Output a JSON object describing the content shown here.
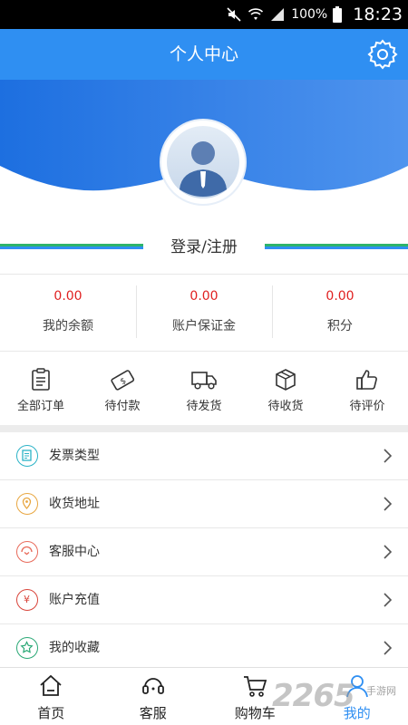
{
  "status_bar": {
    "battery": "100%",
    "time": "18:23"
  },
  "header": {
    "title": "个人中心",
    "settings_icon": "gear-icon"
  },
  "colors": {
    "primary": "#2f8ff2",
    "price": "#e02020",
    "green_line": "#2db46b"
  },
  "login": {
    "label": "登录/注册"
  },
  "stats": [
    {
      "value": "0.00",
      "label": "我的余额"
    },
    {
      "value": "0.00",
      "label": "账户保证金"
    },
    {
      "value": "0.00",
      "label": "积分"
    }
  ],
  "orders": [
    {
      "label": "全部订单",
      "icon": "clipboard-icon"
    },
    {
      "label": "待付款",
      "icon": "payment-icon"
    },
    {
      "label": "待发货",
      "icon": "truck-icon"
    },
    {
      "label": "待收货",
      "icon": "box-icon"
    },
    {
      "label": "待评价",
      "icon": "thumbs-up-icon"
    }
  ],
  "menu": [
    {
      "label": "发票类型",
      "icon": "invoice-icon",
      "color": "#2bb3c7"
    },
    {
      "label": "收货地址",
      "icon": "location-icon",
      "color": "#e8a640"
    },
    {
      "label": "客服中心",
      "icon": "service-icon",
      "color": "#e86a5a"
    },
    {
      "label": "账户充值",
      "icon": "yuan-icon",
      "color": "#d9443a"
    },
    {
      "label": "我的收藏",
      "icon": "star-icon",
      "color": "#2aa876"
    }
  ],
  "tabs": [
    {
      "label": "首页",
      "icon": "home-icon"
    },
    {
      "label": "客服",
      "icon": "headset-icon"
    },
    {
      "label": "购物车",
      "icon": "cart-icon"
    },
    {
      "label": "我的",
      "icon": "user-icon",
      "active": true
    }
  ],
  "watermark": {
    "number": "2265",
    "text": "手游网"
  }
}
